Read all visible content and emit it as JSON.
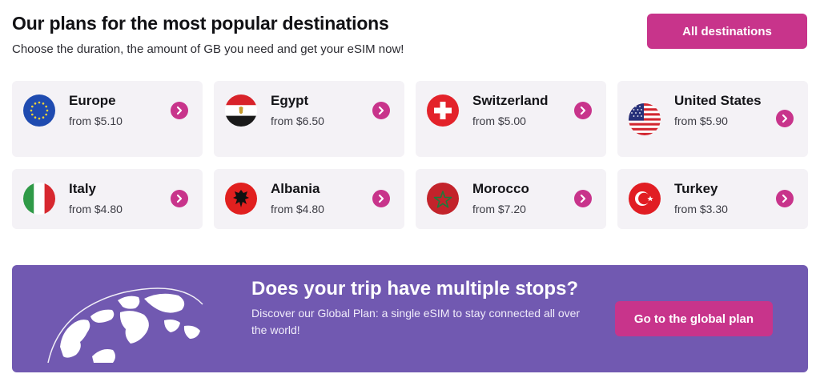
{
  "header": {
    "title": "Our plans for the most popular destinations",
    "subtitle": "Choose the duration, the amount of GB you need and get your eSIM now!",
    "all_destinations_label": "All destinations"
  },
  "destinations": [
    {
      "name": "Europe",
      "price": "from $5.10",
      "flag_icon": "eu-flag-icon"
    },
    {
      "name": "Egypt",
      "price": "from $6.50",
      "flag_icon": "egypt-flag-icon"
    },
    {
      "name": "Switzerland",
      "price": "from $5.00",
      "flag_icon": "switzerland-flag-icon"
    },
    {
      "name": "United States",
      "price": "from $5.90",
      "flag_icon": "usa-flag-icon"
    },
    {
      "name": "Italy",
      "price": "from $4.80",
      "flag_icon": "italy-flag-icon"
    },
    {
      "name": "Albania",
      "price": "from $4.80",
      "flag_icon": "albania-flag-icon"
    },
    {
      "name": "Morocco",
      "price": "from $7.20",
      "flag_icon": "morocco-flag-icon"
    },
    {
      "name": "Turkey",
      "price": "from $3.30",
      "flag_icon": "turkey-flag-icon"
    }
  ],
  "banner": {
    "title": "Does your trip have multiple stops?",
    "description": "Discover our Global Plan: a single eSIM to stay connected all over the world!",
    "button_label": "Go to the global plan",
    "icon": "globe-icon"
  },
  "colors": {
    "accent": "#c8348b",
    "card_bg": "#f4f2f6",
    "banner_bg": "#7159b1"
  }
}
